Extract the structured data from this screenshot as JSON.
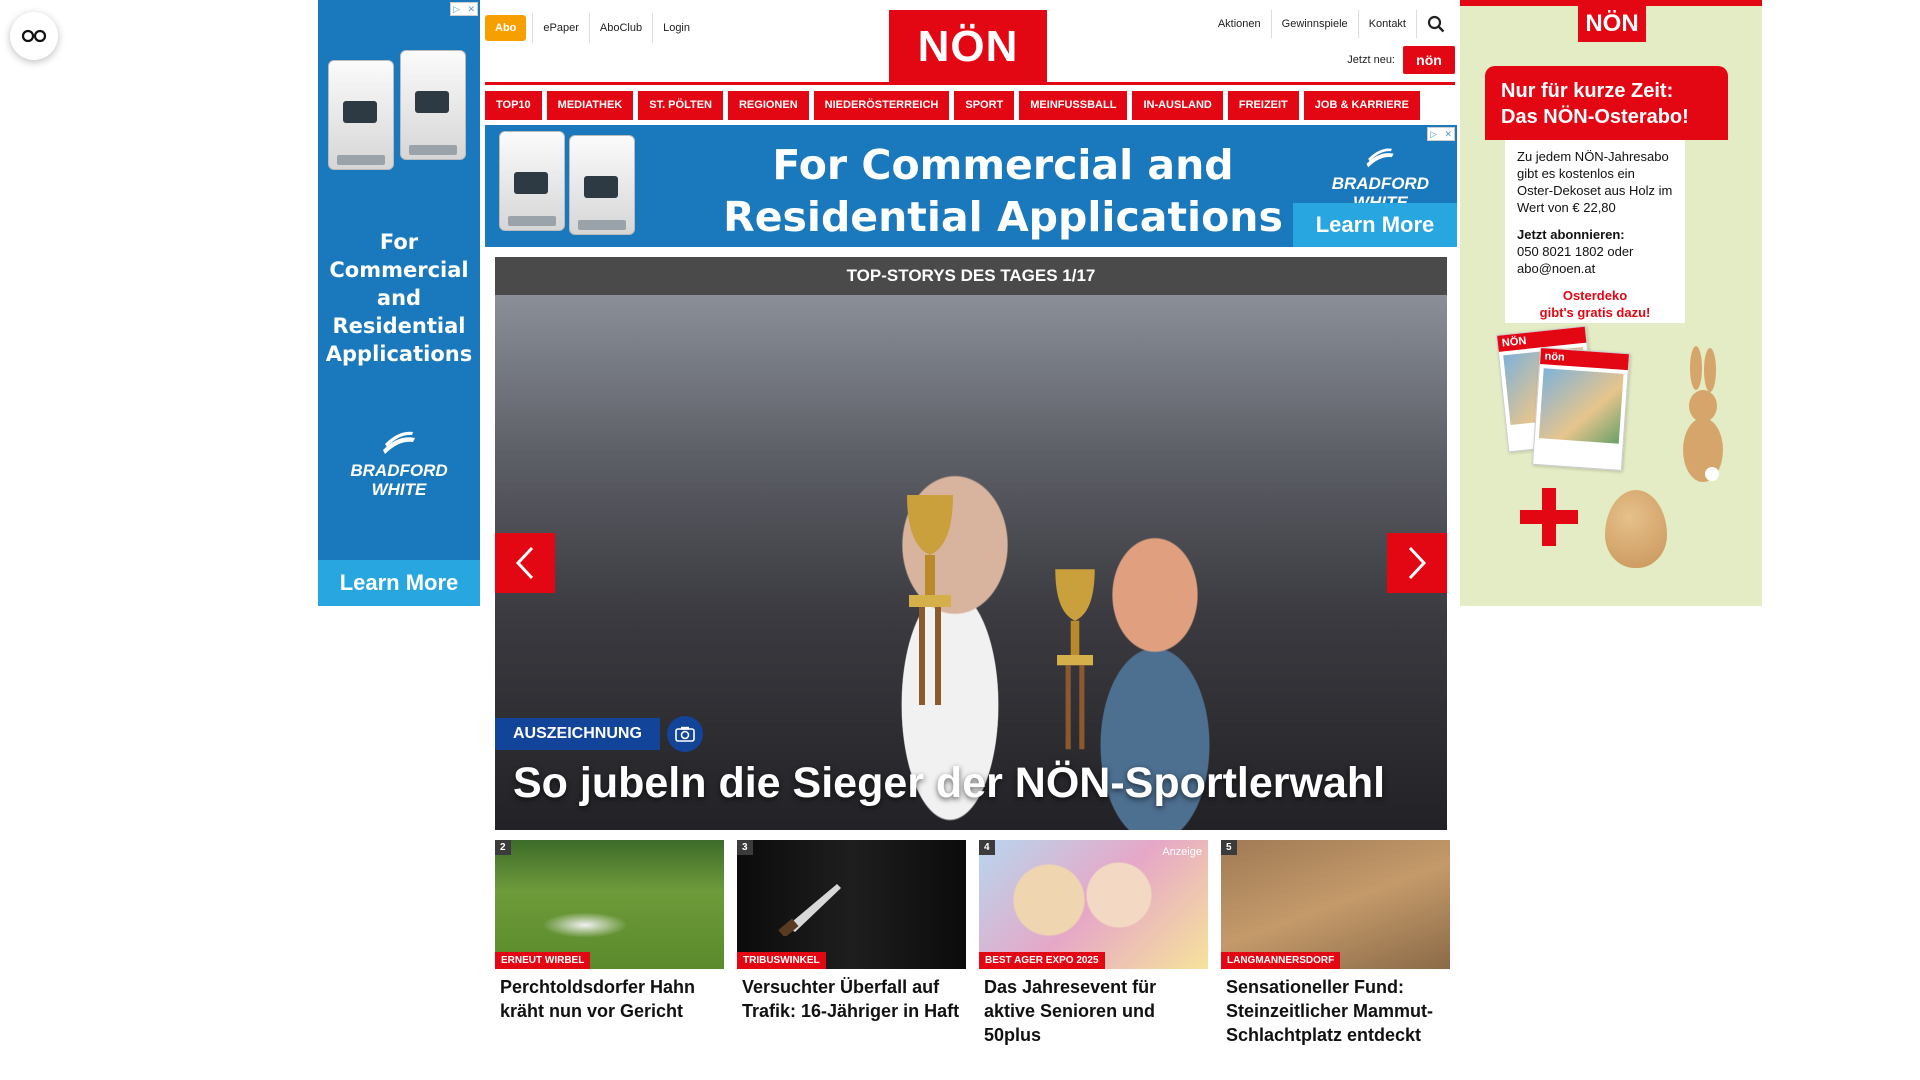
{
  "reader_icon": "glasses-icon",
  "ad_left": {
    "headline": "For Commercial and Residential Applications",
    "brand_line1": "BRADFORD",
    "brand_line2": "WHITE",
    "cta": "Learn More",
    "color": "#1a79bd",
    "cta_color": "#27a6e0"
  },
  "header": {
    "abo": "Abo",
    "links": [
      "ePaper",
      "AboClub",
      "Login"
    ],
    "logo": "NÖN",
    "right_links": [
      "Aktionen",
      "Gewinnspiele",
      "Kontakt"
    ],
    "jetzt_neu": "Jetzt neu:",
    "jetzt_logo": "nön",
    "brand_color": "#e30613",
    "abo_color": "#f5a000"
  },
  "categories": [
    "TOP10",
    "MEDIATHEK",
    "ST. PÖLTEN",
    "REGIONEN",
    "NIEDERÖSTERREICH",
    "SPORT",
    "MEINFUSSBALL",
    "IN-AUSLAND",
    "FREIZEIT",
    "JOB & KARRIERE"
  ],
  "banner": {
    "line1": "For Commercial and",
    "line2": "Residential Applications",
    "brand_line1": "BRADFORD",
    "brand_line2": "WHITE",
    "cta": "Learn More"
  },
  "hero": {
    "header": "TOP-STORYS DES TAGES 1/17",
    "tag": "AUSZEICHNUNG",
    "title": "So jubeln die Sieger der NÖN-Sportlerwahl",
    "tag_color": "#12449a"
  },
  "cards": [
    {
      "num": "2",
      "kicker": "ERNEUT WIRBEL",
      "title": "Perchtoldsdorfer Hahn kräht nun vor Gericht",
      "ad": ""
    },
    {
      "num": "3",
      "kicker": "TRIBUSWINKEL",
      "title": "Versuchter Überfall auf Trafik: 16-Jähriger in Haft",
      "ad": ""
    },
    {
      "num": "4",
      "kicker": "BEST AGER EXPO 2025",
      "title": "Das Jahresevent für aktive Senioren und 50plus",
      "ad": "Anzeige"
    },
    {
      "num": "5",
      "kicker": "LANGMANNERSDORF",
      "title": "Sensationeller Fund: Steinzeitlicher Mammut-Schlachtplatz entdeckt",
      "ad": ""
    }
  ],
  "ad_right": {
    "logo": "NÖN",
    "badge_line1": "Nur für kurze Zeit:",
    "badge_line2": "Das NÖN-Osterabo!",
    "info_text": "Zu jedem NÖN-Jahresabo gibt es kostenlos ein Oster-Dekoset aus Holz im Wert von € 22,80",
    "subscribe_label": "Jetzt abonnieren:",
    "contact": "050 8021 1802 oder abo@noen.at",
    "red_line1": "Osterdeko",
    "red_line2": "gibt's gratis dazu!",
    "mag_logo_1": "NÖN",
    "mag_logo_2": "nön"
  }
}
